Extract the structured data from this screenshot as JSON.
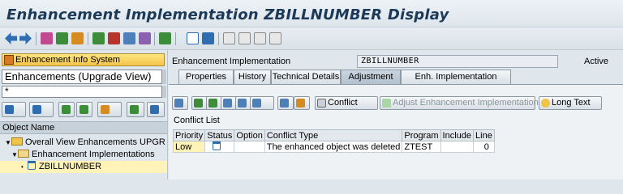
{
  "title": "Enhancement Implementation ZBILLNUMBER Display",
  "toolbar": {
    "icons": [
      "back-icon",
      "forward-icon",
      "other-object-icon",
      "display-change-icon",
      "activate-icon",
      "check-icon",
      "edit-icon",
      "where-used-icon",
      "hierarchy-icon",
      "tree-icon",
      "layout-icon",
      "info-icon",
      "cut-icon",
      "copy-icon",
      "paste-icon",
      "find-icon"
    ]
  },
  "left": {
    "info_system_button": "Enhancement Info System",
    "view_select": "Enhancements (Upgrade View)",
    "input_value": "*",
    "object_name_header": "Object Name",
    "tree": [
      {
        "label": "Overall View Enhancements UPGR"
      },
      {
        "label": "Enhancement Implementations"
      },
      {
        "label": "ZBILLNUMBER"
      }
    ]
  },
  "right": {
    "header_label": "Enhancement Implementation",
    "header_value": "ZBILLNUMBER",
    "header_status": "Active",
    "tabs": [
      {
        "label": "Properties"
      },
      {
        "label": "History"
      },
      {
        "label": "Technical Details"
      },
      {
        "label": "Adjustment"
      },
      {
        "label": "Enh. Implementation Elements"
      }
    ],
    "active_tab": "Adjustment",
    "buttons": {
      "conflict": "Conflict",
      "adjust": "Adjust Enhancement Implementation",
      "long_text": "Long Text"
    },
    "conflict_list_title": "Conflict List",
    "table": {
      "columns": [
        "Priority",
        "Status",
        "Option",
        "Conflict Type",
        "Program",
        "Include",
        "Line"
      ],
      "rows": [
        {
          "priority": "Low",
          "status_icon": "trash-icon",
          "option": "",
          "conflict_type": "The enhanced object was deleted",
          "program": "ZTEST",
          "include": "",
          "line": "0"
        }
      ]
    }
  },
  "colors": {
    "title": "#1c3a57",
    "highlight": "#fff3b8",
    "info_button": "#f3c44b"
  }
}
